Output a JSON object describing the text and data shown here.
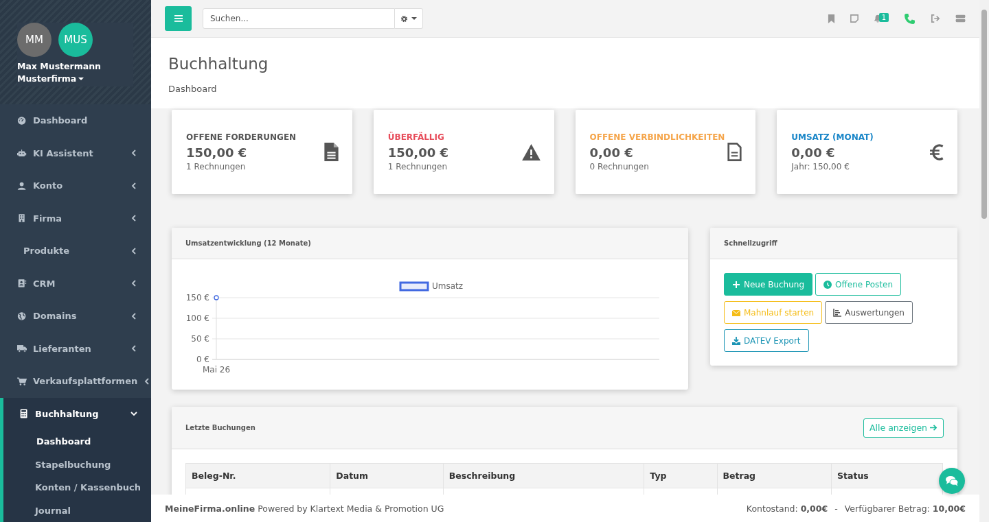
{
  "profile": {
    "avatars": [
      {
        "initials": "MM",
        "color": "#6c6c6c"
      },
      {
        "initials": "MUS",
        "color": "#1abc9c"
      }
    ],
    "name": "Max Mustermann",
    "company": "Musterfirma"
  },
  "sidebar": {
    "items": [
      {
        "label": "Dashboard",
        "selected": false
      },
      {
        "label": "KI Assistent",
        "selected": false,
        "expanded": false
      },
      {
        "label": "Konto",
        "selected": false,
        "expanded": false
      },
      {
        "label": "Firma",
        "selected": false,
        "expanded": false
      },
      {
        "label": "Produkte",
        "selected": false,
        "expanded": false
      },
      {
        "label": "CRM",
        "selected": false,
        "expanded": false
      },
      {
        "label": "Domains",
        "selected": false,
        "expanded": false
      },
      {
        "label": "Lieferanten",
        "selected": false,
        "expanded": false
      },
      {
        "label": "Verkaufsplattformen",
        "selected": false,
        "expanded": false
      },
      {
        "label": "Buchhaltung",
        "selected": true,
        "expanded": true,
        "children": [
          {
            "label": "Dashboard",
            "selected": true
          },
          {
            "label": "Stapelbuchung",
            "selected": false
          },
          {
            "label": "Konten / Kassenbuch",
            "selected": false
          },
          {
            "label": "Journal",
            "selected": false
          }
        ]
      }
    ]
  },
  "header": {
    "search": {
      "placeholder": "Suchen..."
    },
    "notification_count": "1"
  },
  "page": {
    "title": "Buchhaltung",
    "breadcrumb": "Dashboard"
  },
  "stats": [
    {
      "label": "OFFENE FORDERUNGEN",
      "color": "#555555",
      "value": "150,00 €",
      "sub": "1 Rechnungen"
    },
    {
      "label": "ÜBERFÄLLIG",
      "color": "#e74c5a",
      "value": "150,00 €",
      "sub": "1 Rechnungen"
    },
    {
      "label": "OFFENE VERBINDLICHKEITEN",
      "color": "#f5a54a",
      "value": "0,00 €",
      "sub": "0 Rechnungen"
    },
    {
      "label": "UMSATZ (MONAT)",
      "color": "#1a86c8",
      "value": "0,00 €",
      "sub": "Jahr: 150,00 €"
    }
  ],
  "revenue_panel": {
    "title": "Umsatzentwicklung (12 Monate)",
    "chart_data": {
      "type": "line",
      "categories": [
        "Mai 26"
      ],
      "series": [
        {
          "name": "Umsatz",
          "color": "#4169e1",
          "marker": true,
          "values": [
            150
          ]
        }
      ],
      "grid": true,
      "ylim": [
        0,
        150
      ],
      "yticks": [
        {
          "value": 0,
          "label": "0 €"
        },
        {
          "value": 50,
          "label": "50 €"
        },
        {
          "value": 100,
          "label": "100 €"
        },
        {
          "value": 150,
          "label": "150 €"
        }
      ]
    }
  },
  "quick_panel": {
    "title": "Schnellzugriff",
    "buttons": [
      {
        "label": "Neue Buchung",
        "kind": "primary"
      },
      {
        "label": "Offene Posten",
        "kind": "success"
      },
      {
        "label": "Mahnlauf starten",
        "kind": "warning"
      },
      {
        "label": "Auswertungen",
        "kind": "secondary"
      },
      {
        "label": "DATEV Export",
        "kind": "info"
      }
    ]
  },
  "bookings_panel": {
    "title": "Letzte Buchungen",
    "link": "Alle anzeigen",
    "columns": [
      "Beleg-Nr.",
      "Datum",
      "Beschreibung",
      "Typ",
      "Betrag",
      "Status"
    ]
  },
  "footer": {
    "left": "**MeineFirma.online** Powered by Klartext Media & Promotion UG",
    "balance": "Kontostand: **0,00€**",
    "separator": "-",
    "available": "Verfügbarer Betrag: **10,00€**"
  }
}
